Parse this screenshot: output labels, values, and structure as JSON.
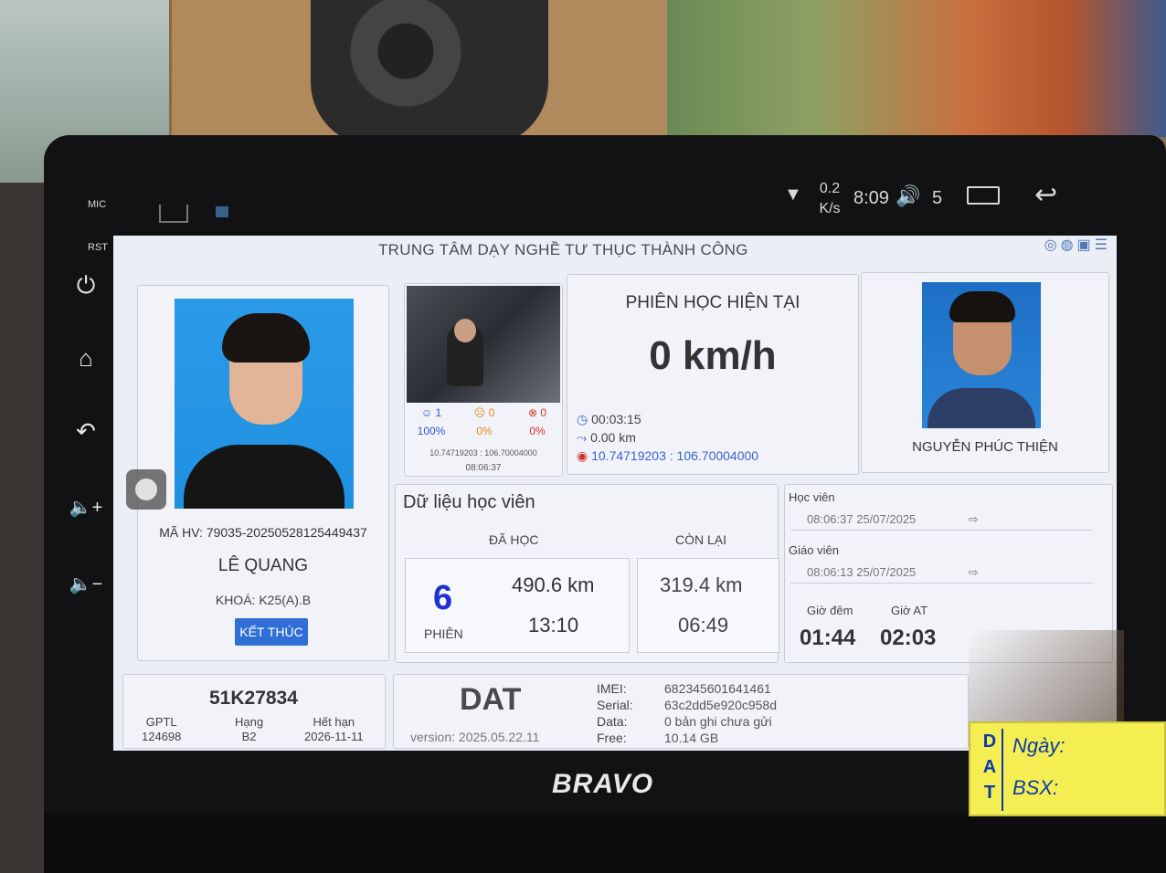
{
  "device_bezel": {
    "mic_label": "MIC",
    "rst_label": "RST",
    "brand": "BRAVO"
  },
  "status_bar": {
    "net_speed_value": "0.2",
    "net_speed_unit": "K/s",
    "time": "8:09",
    "volume": "5"
  },
  "app": {
    "title": "TRUNG TÂM DẠY NGHỀ TƯ THỤC THÀNH CÔNG",
    "student": {
      "code": "MÃ HV: 79035-20250528125449437",
      "name": "LÊ QUANG",
      "course": "KHOÁ: K25(A).B",
      "end_button": "KẾT THÚC"
    },
    "snapshot": {
      "stat1_count": "1",
      "stat1_pct": "100%",
      "stat2_count": "0",
      "stat2_pct": "0%",
      "stat3_count": "0",
      "stat3_pct": "0%",
      "coords": "10.74719203 : 106.70004000",
      "time": "08:06:37",
      "colors": {
        "ok": "#3355cc",
        "warn": "#e08a1e",
        "bad": "#d0322a"
      }
    },
    "session": {
      "title": "PHIÊN HỌC HIỆN TẠI",
      "speed": "0 km/h",
      "duration": "00:03:15",
      "distance": "0.00 km",
      "gps": "10.74719203 : 106.70004000"
    },
    "teacher": {
      "name": "NGUYỄN PHÚC THIỆN"
    },
    "student_data": {
      "title": "Dữ liệu học viên",
      "learned_header": "ĐÃ HỌC",
      "remaining_header": "CÒN LẠI",
      "sessions": "6",
      "sessions_label": "PHIÊN",
      "learned_km": "490.6 km",
      "learned_time": "13:10",
      "remaining_km": "319.4 km",
      "remaining_time": "06:49"
    },
    "logins": {
      "student_label": "Học viên",
      "student_time": "08:06:37 25/07/2025",
      "teacher_label": "Giáo viên",
      "teacher_time": "08:06:13 25/07/2025",
      "night_label": "Giờ đêm",
      "night_value": "01:44",
      "at_label": "Giờ AT",
      "at_value": "02:03"
    },
    "vehicle": {
      "plate": "51K27834",
      "gptl_label": "GPTL",
      "gptl_value": "124698",
      "class_label": "Hạng",
      "class_value": "B2",
      "expiry_label": "Hết hạn",
      "expiry_value": "2026-11-11"
    },
    "device": {
      "logo": "DAT",
      "version": "version: 2025.05.22.11",
      "imei_label": "IMEI:",
      "imei": "682345601641461",
      "serial_label": "Serial:",
      "serial": "63c2dd5e920c958d",
      "data_label": "Data:",
      "data": "0 bản ghi chưa gửi",
      "free_label": "Free:",
      "free": "10.14 GB"
    }
  },
  "sticker": {
    "letters": [
      "D",
      "A",
      "T"
    ],
    "date_label": "Ngày:",
    "plate_label": "BSX:"
  }
}
